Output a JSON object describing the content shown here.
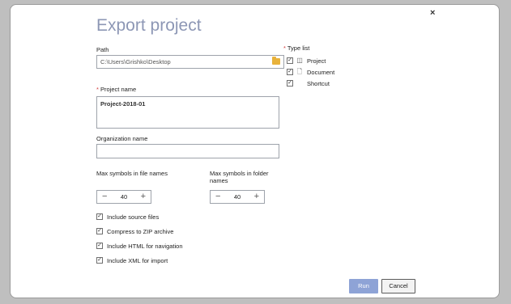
{
  "dialog": {
    "title": "Export project",
    "close_glyph": "×"
  },
  "path": {
    "label": "Path",
    "value": "C:\\Users\\Grishko\\Desktop",
    "icon": "folder-icon"
  },
  "project_name": {
    "required_mark": "*",
    "label": "Project name",
    "value": "Project-2018-01"
  },
  "organization_name": {
    "label": "Organization name",
    "value": ""
  },
  "max_file_symbols": {
    "label": "Max symbols in file names",
    "value": "40",
    "minus": "−",
    "plus": "+"
  },
  "max_folder_symbols": {
    "label_line1": "Max symbols in folder",
    "label_line2": "names",
    "value": "40",
    "minus": "−",
    "plus": "+"
  },
  "options": [
    {
      "label": "Include source files",
      "checked": true
    },
    {
      "label": "Compress to ZIP archive",
      "checked": true
    },
    {
      "label": "Include HTML for navigation",
      "checked": true
    },
    {
      "label": "Include XML for import",
      "checked": true
    }
  ],
  "type_list": {
    "required_mark": "*",
    "label": "Type list",
    "items": [
      {
        "label": "Project",
        "checked": true,
        "icon": "project-icon"
      },
      {
        "label": "Document",
        "checked": true,
        "icon": "document-icon"
      },
      {
        "label": "Shortcut",
        "checked": true,
        "icon": ""
      }
    ]
  },
  "check_glyph": "✓",
  "buttons": {
    "run": "Run",
    "cancel": "Cancel"
  },
  "colors": {
    "title": "#8d97b5",
    "run_button": "#8ea3d6",
    "required": "#d23a3a",
    "folder": "#e8b23b"
  }
}
